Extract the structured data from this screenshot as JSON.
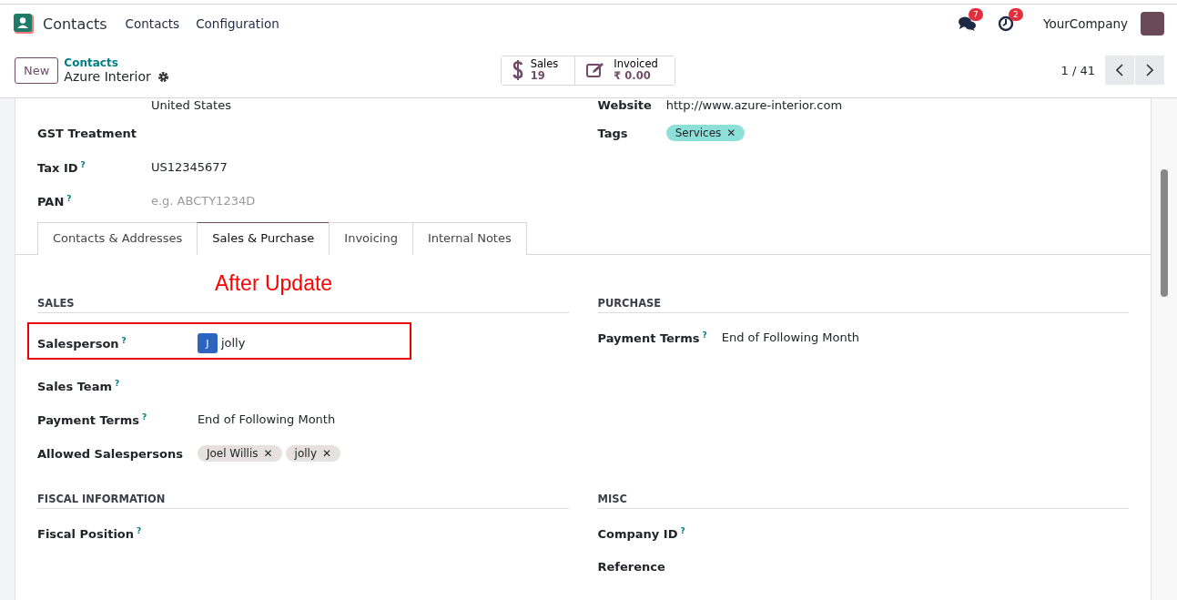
{
  "navbar": {
    "app_name": "Contacts",
    "menu": [
      "Contacts",
      "Configuration"
    ],
    "messages_count": "7",
    "activities_count": "2",
    "company": "YourCompany"
  },
  "control_panel": {
    "new_button": "New",
    "breadcrumb": "Contacts",
    "record": "Azure Interior",
    "smart_buttons": [
      {
        "kind": "dollar",
        "label": "Sales",
        "value": "19"
      },
      {
        "kind": "edit",
        "label": "Invoiced",
        "value": "₹ 0.00"
      }
    ],
    "pager": "1 / 41"
  },
  "header_groups": [
    {
      "fields": [
        {
          "kind": "text",
          "value": "United States"
        },
        {
          "label": "GST Treatment",
          "kind": "empty"
        },
        {
          "label": "Tax ID",
          "help": "?",
          "kind": "text",
          "value": "US12345677"
        },
        {
          "label": "PAN",
          "help": "?",
          "kind": "placeholder",
          "placeholder": "e.g. ABCTY1234D"
        }
      ]
    },
    {
      "fields": [
        {
          "label": "Website",
          "kind": "text",
          "value": "http://www.azure-interior.com"
        },
        {
          "label": "Tags",
          "kind": "tags",
          "tags": [
            {
              "label": "Services",
              "remove": "✕",
              "color": "#8de0d8"
            }
          ]
        }
      ]
    }
  ],
  "tabs": [
    {
      "label": "Contacts & Addresses",
      "selected": false
    },
    {
      "label": "Sales & Purchase",
      "selected": true
    },
    {
      "label": "Invoicing",
      "selected": false
    },
    {
      "label": "Internal Notes",
      "selected": false
    }
  ],
  "annotation": "After Update",
  "sections": [
    {
      "title": "SALES",
      "fields": [
        {
          "label": "Salesperson",
          "help": "?",
          "kind": "avatar",
          "initial": "J",
          "value": "jolly",
          "highlighted": true
        },
        {
          "label": "Sales Team",
          "help": "?",
          "kind": "empty"
        },
        {
          "label": "Payment Terms",
          "help": "?",
          "kind": "text",
          "value": "End of Following Month"
        },
        {
          "label": "Allowed Salespersons",
          "kind": "tags",
          "tags": [
            {
              "label": "Joel Willis",
              "remove": "✕",
              "color": "#e6e0df"
            },
            {
              "label": "jolly",
              "remove": "✕",
              "color": "#e6e0df"
            }
          ]
        }
      ]
    },
    {
      "title": "PURCHASE",
      "fields": [
        {
          "label": "Payment Terms",
          "help": "?",
          "kind": "text",
          "value": "End of Following Month"
        }
      ]
    },
    {
      "title": "FISCAL INFORMATION",
      "fields": [
        {
          "label": "Fiscal Position",
          "help": "?",
          "kind": "empty"
        }
      ]
    },
    {
      "title": "MISC",
      "fields": [
        {
          "label": "Company ID",
          "help": "?",
          "kind": "empty"
        },
        {
          "label": "Reference",
          "kind": "empty"
        }
      ]
    }
  ]
}
